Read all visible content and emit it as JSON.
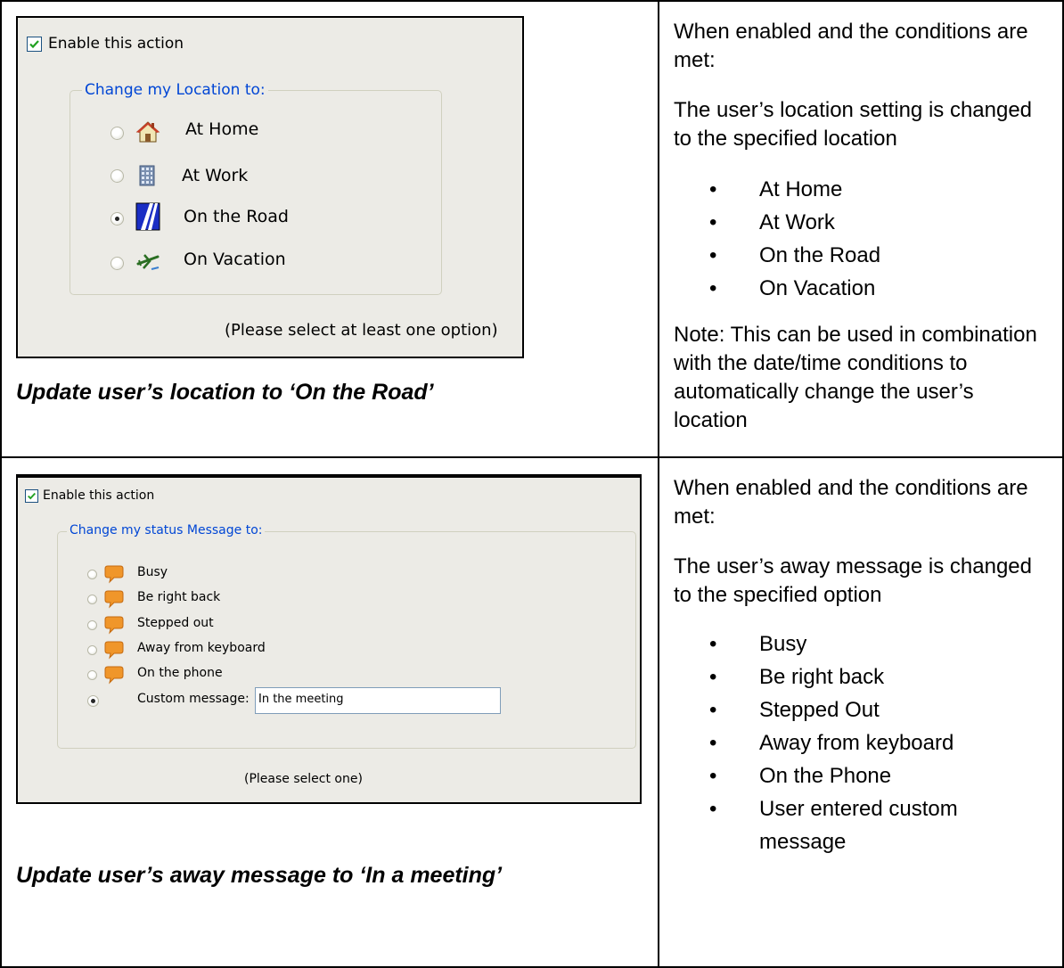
{
  "row1": {
    "dialog": {
      "enable_label": "Enable this action",
      "group_title": "Change my Location to:",
      "options": [
        {
          "label": "At Home",
          "icon": "house-icon"
        },
        {
          "label": "At Work",
          "icon": "building-icon"
        },
        {
          "label": "On the Road",
          "icon": "road-icon"
        },
        {
          "label": "On Vacation",
          "icon": "airplane-icon"
        }
      ],
      "selected_index": 2,
      "hint": "(Please select at least one option)"
    },
    "caption": "Update user’s location to ‘On the Road’",
    "description": {
      "p1": "When enabled and the conditions are met:",
      "p2": "The user’s location setting is changed to the specified location",
      "bullets": [
        "At Home",
        "At Work",
        "On the Road",
        "On Vacation"
      ],
      "note": "Note: This can be used in combination with the date/time conditions to automatically change the user’s location"
    }
  },
  "row2": {
    "dialog": {
      "enable_label": "Enable this action",
      "group_title": "Change my status Message to:",
      "options": [
        {
          "label": "Busy",
          "icon": "speech-bubble-icon"
        },
        {
          "label": "Be right back",
          "icon": "speech-bubble-icon"
        },
        {
          "label": "Stepped out",
          "icon": "speech-bubble-icon"
        },
        {
          "label": "Away from keyboard",
          "icon": "speech-bubble-icon"
        },
        {
          "label": "On the phone",
          "icon": "speech-bubble-icon"
        }
      ],
      "custom_label": "Custom message:",
      "custom_value": "In the meeting",
      "hint": "(Please select one)"
    },
    "caption": "Update user’s away message to ‘In a meeting’",
    "description": {
      "p1": "When enabled and the conditions are met:",
      "p2": "The user’s away message is changed to the specified option",
      "bullets": [
        "Busy",
        "Be right back",
        "Stepped Out",
        "Away from keyboard",
        "On the Phone",
        "User entered custom message"
      ]
    }
  },
  "colors": {
    "legend_blue": "#0046d5",
    "panel_bg": "#ecebe6",
    "check_green": "#21a121",
    "bubble_orange": "#f0962a"
  }
}
